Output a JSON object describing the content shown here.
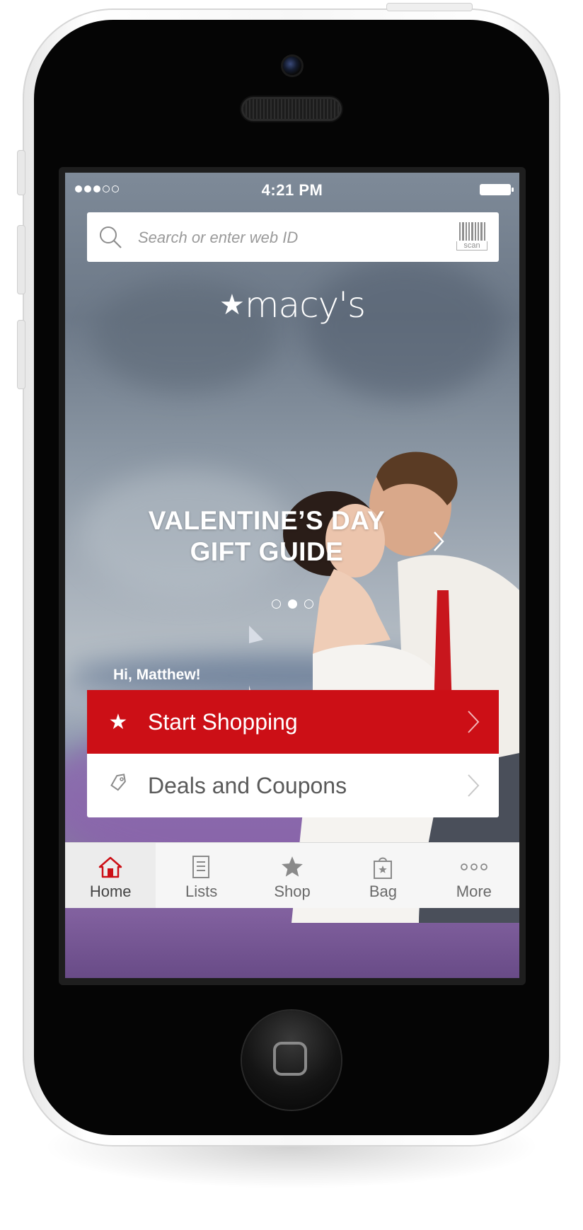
{
  "status_bar": {
    "signal_dots_filled": 3,
    "signal_dots_total": 5,
    "time": "4:21 PM"
  },
  "search": {
    "placeholder": "Search or enter web ID",
    "scan_label": "scan"
  },
  "logo": {
    "star": "★",
    "text": "macy's"
  },
  "promo": {
    "title_line1": "VALENTINE’S DAY",
    "title_line2": "GIFT GUIDE",
    "carousel_total": 3,
    "carousel_active": 2
  },
  "greeting": "Hi, Matthew!",
  "actions": {
    "start_shopping": {
      "icon": "star-icon",
      "label": "Start Shopping"
    },
    "deals": {
      "icon": "tag-icon",
      "label": "Deals and Coupons"
    }
  },
  "tabs": [
    {
      "label": "Home",
      "icon": "home-icon",
      "active": true
    },
    {
      "label": "Lists",
      "icon": "list-icon",
      "active": false
    },
    {
      "label": "Shop",
      "icon": "star-icon",
      "active": false
    },
    {
      "label": "Bag",
      "icon": "bag-icon",
      "active": false
    },
    {
      "label": "More",
      "icon": "more-icon",
      "active": false
    }
  ],
  "colors": {
    "brand_red": "#cc0f16",
    "tab_active_icon": "#cc0f16",
    "tab_inactive_icon": "#8a8a8a"
  }
}
